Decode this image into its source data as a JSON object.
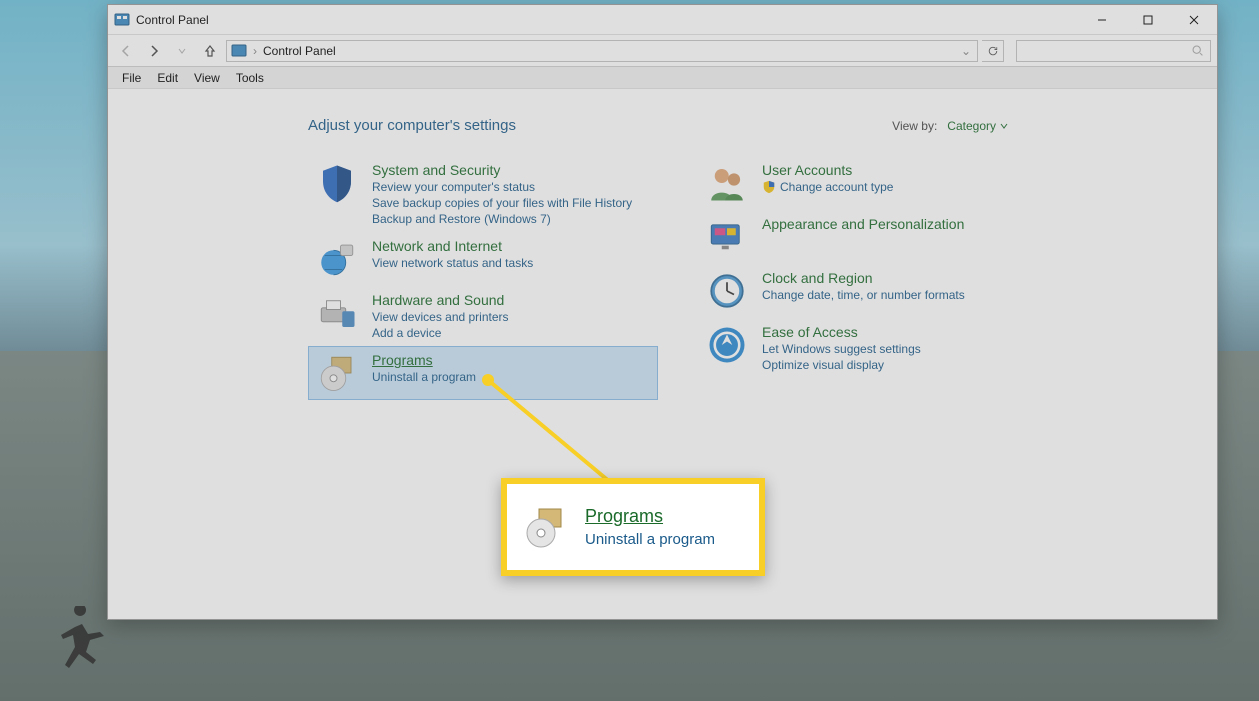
{
  "desktop": {},
  "window": {
    "title": "Control Panel",
    "breadcrumb": {
      "root": "Control Panel"
    },
    "menus": [
      "File",
      "Edit",
      "View",
      "Tools"
    ]
  },
  "header": {
    "title": "Adjust your computer's settings",
    "view_by_label": "View by:",
    "view_by_value": "Category"
  },
  "categories": {
    "left": [
      {
        "title": "System and Security",
        "links": [
          "Review your computer's status",
          "Save backup copies of your files with File History",
          "Backup and Restore (Windows 7)"
        ],
        "icon": "shield-blue"
      },
      {
        "title": "Network and Internet",
        "links": [
          "View network status and tasks"
        ],
        "icon": "globe"
      },
      {
        "title": "Hardware and Sound",
        "links": [
          "View devices and printers",
          "Add a device"
        ],
        "icon": "printer"
      },
      {
        "title": "Programs",
        "links": [
          "Uninstall a program"
        ],
        "icon": "disc",
        "selected": true
      }
    ],
    "right": [
      {
        "title": "User Accounts",
        "links_shielded": [
          "Change account type"
        ],
        "icon": "people"
      },
      {
        "title": "Appearance and Personalization",
        "links": [],
        "icon": "monitor"
      },
      {
        "title": "Clock and Region",
        "links": [
          "Change date, time, or number formats"
        ],
        "icon": "clock"
      },
      {
        "title": "Ease of Access",
        "links": [
          "Let Windows suggest settings",
          "Optimize visual display"
        ],
        "icon": "access"
      }
    ]
  },
  "callout": {
    "title": "Programs",
    "sub": "Uninstall a program"
  }
}
